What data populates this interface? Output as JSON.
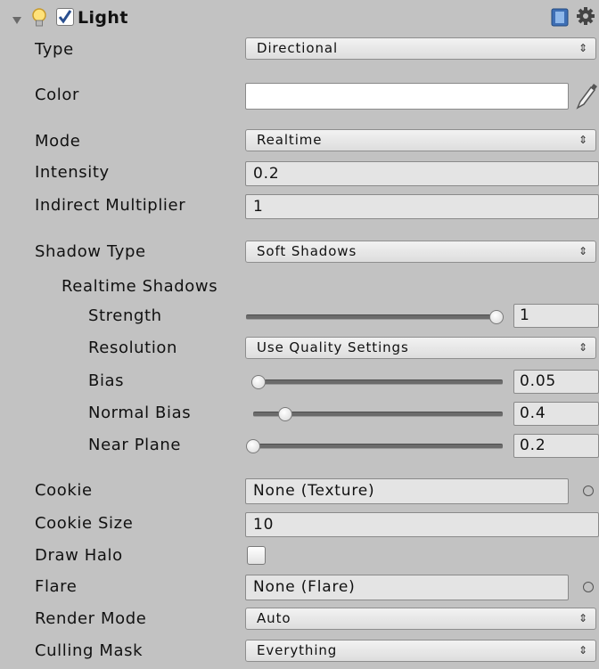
{
  "header": {
    "title": "Light",
    "enabled": true
  },
  "icons": {
    "fold": "foldout-arrow-down",
    "light": "light-bulb-icon",
    "help": "book-help-icon",
    "settings": "gear-icon",
    "eyedropper": "eyedropper-icon",
    "object_picker": "object-picker-icon"
  },
  "type": {
    "label": "Type",
    "value": "Directional"
  },
  "color": {
    "label": "Color",
    "value": "#ffffff"
  },
  "mode": {
    "label": "Mode",
    "value": "Realtime"
  },
  "intensity": {
    "label": "Intensity",
    "value": "0.2"
  },
  "indirect": {
    "label": "Indirect Multiplier",
    "value": "1"
  },
  "shadow_type": {
    "label": "Shadow Type",
    "value": "Soft Shadows"
  },
  "realtime_shadows": {
    "label": "Realtime Shadows"
  },
  "strength": {
    "label": "Strength",
    "value": "1",
    "fraction": 1.0
  },
  "resolution": {
    "label": "Resolution",
    "value": "Use Quality Settings"
  },
  "bias": {
    "label": "Bias",
    "value": "0.05",
    "fraction": 0.02
  },
  "normal_bias": {
    "label": "Normal Bias",
    "value": "0.4",
    "fraction": 0.13
  },
  "near_plane": {
    "label": "Near Plane",
    "value": "0.2",
    "fraction": 0.0
  },
  "cookie": {
    "label": "Cookie",
    "value": "None (Texture)"
  },
  "cookie_size": {
    "label": "Cookie Size",
    "value": "10"
  },
  "draw_halo": {
    "label": "Draw Halo",
    "checked": false
  },
  "flare": {
    "label": "Flare",
    "value": "None (Flare)"
  },
  "render_mode": {
    "label": "Render Mode",
    "value": "Auto"
  },
  "culling_mask": {
    "label": "Culling Mask",
    "value": "Everything"
  }
}
